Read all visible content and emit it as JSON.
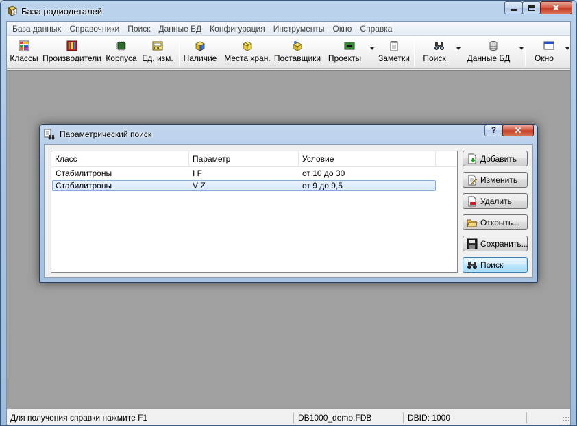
{
  "window": {
    "title": "База радиодеталей",
    "close_glyph": "✕"
  },
  "menu": [
    "База данных",
    "Справочники",
    "Поиск",
    "Данные БД",
    "Конфигурация",
    "Инструменты",
    "Окно",
    "Справка"
  ],
  "toolbar": [
    {
      "label": "Классы",
      "icon": "classes-icon"
    },
    {
      "label": "Производители",
      "icon": "manufacturers-icon"
    },
    {
      "label": "Корпуса",
      "icon": "chip-package-icon"
    },
    {
      "label": "Ед. изм.",
      "icon": "units-icon"
    },
    {
      "label": "Наличие",
      "icon": "stock-boxes-icon"
    },
    {
      "label": "Места хран.",
      "icon": "storage-icon"
    },
    {
      "label": "Поставщики",
      "icon": "suppliers-icon"
    },
    {
      "label": "Проекты",
      "icon": "projects-board-icon"
    },
    {
      "label": "Заметки",
      "icon": "notes-icon"
    },
    {
      "label": "Поиск",
      "icon": "binoculars-icon"
    },
    {
      "label": "Данные БД",
      "icon": "database-icon"
    },
    {
      "label": "Окно",
      "icon": "window-icon"
    }
  ],
  "dialog": {
    "title": "Параметрический поиск",
    "help_glyph": "?",
    "close_glyph": "✕",
    "columns": [
      "Класс",
      "Параметр",
      "Условие"
    ],
    "rows": [
      {
        "class": "Стабилитроны",
        "param": "I F",
        "condition": "от 10 до 30"
      },
      {
        "class": "Стабилитроны",
        "param": "V Z",
        "condition": "от 9 до 9,5"
      }
    ],
    "selected_row": 1,
    "buttons": {
      "add": "Добавить",
      "edit": "Изменить",
      "delete": "Удалить",
      "open": "Открыть...",
      "save": "Сохранить...",
      "search": "Поиск"
    }
  },
  "status": {
    "help": "Для получения справки нажмите F1",
    "db_file": "DB1000_demo.FDB",
    "dbid": "DBID: 1000"
  },
  "colors": {
    "mdi_background": "#a0a0a0",
    "selection": "#d8e9fb",
    "selection_border": "#84acdd"
  }
}
